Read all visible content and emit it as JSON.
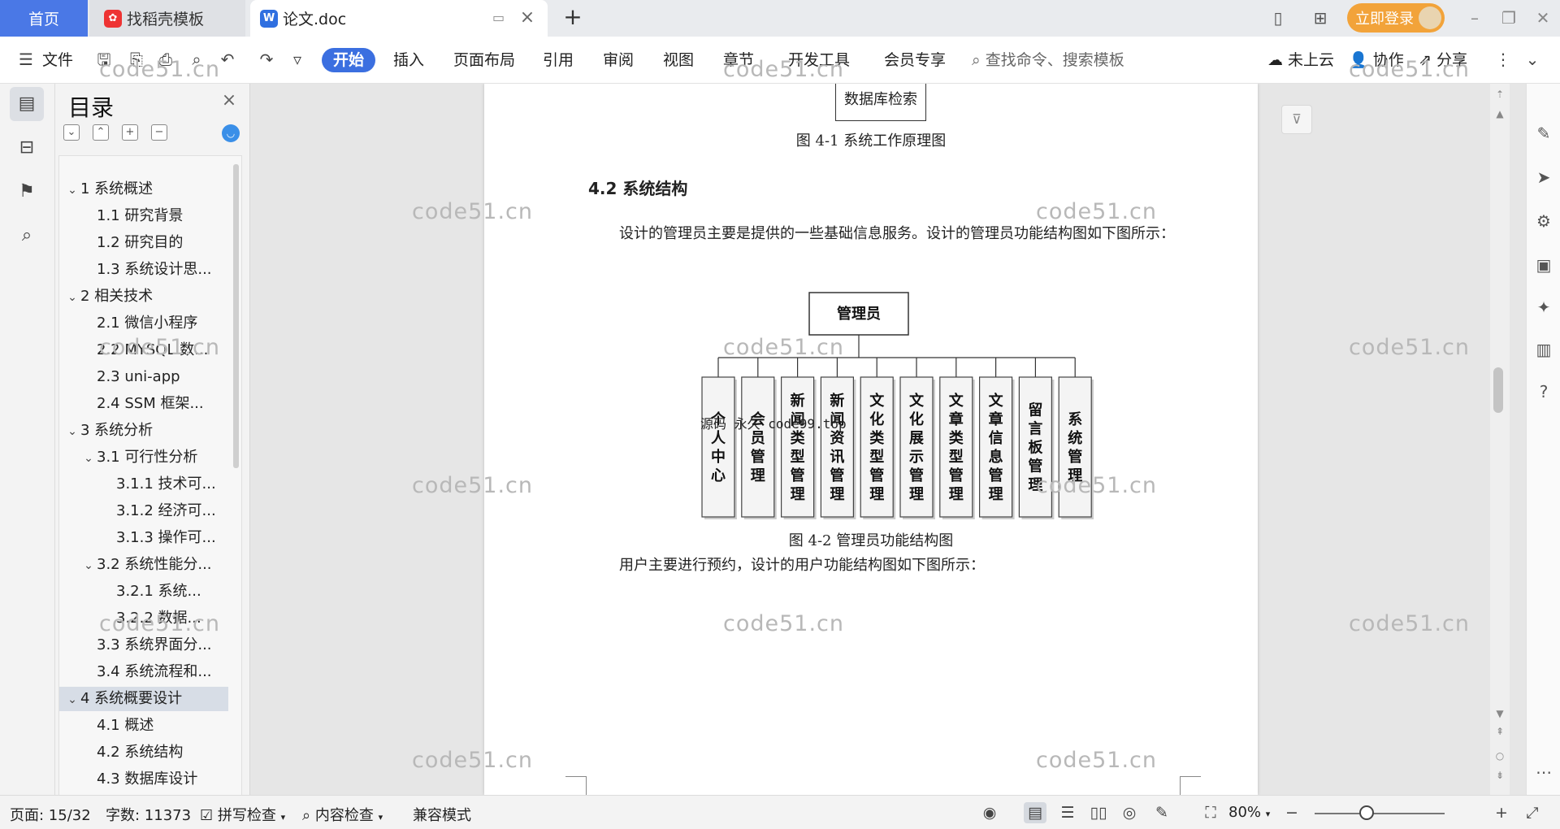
{
  "tabs": {
    "home": "首页",
    "templates": "找稻壳模板",
    "document": "论文.doc"
  },
  "header": {
    "login_label": "立即登录"
  },
  "ribbon": {
    "file_label": "文件",
    "menu": [
      "开始",
      "插入",
      "页面布局",
      "引用",
      "审阅",
      "视图",
      "章节",
      "开发工具",
      "会员专享"
    ],
    "search_placeholder": "查找命令、搜索模板",
    "cloud_label": "未上云",
    "collab_label": "协作",
    "share_label": "分享"
  },
  "toc": {
    "title": "目录",
    "items": [
      {
        "label": "1 系统概述",
        "level": 1,
        "chevron": true
      },
      {
        "label": "1.1  研究背景",
        "level": 2,
        "chevron": false
      },
      {
        "label": "1.2 研究目的",
        "level": 2,
        "chevron": false
      },
      {
        "label": "1.3 系统设计思...",
        "level": 2,
        "chevron": false
      },
      {
        "label": "2 相关技术",
        "level": 1,
        "chevron": true
      },
      {
        "label": "2.1 微信小程序",
        "level": 2,
        "chevron": false
      },
      {
        "label": "2.2 MYSQL 数...",
        "level": 2,
        "chevron": false
      },
      {
        "label": "2.3 uni-app",
        "level": 2,
        "chevron": false
      },
      {
        "label": "2.4 SSM 框架...",
        "level": 2,
        "chevron": false
      },
      {
        "label": "3 系统分析",
        "level": 1,
        "chevron": true
      },
      {
        "label": "3.1 可行性分析",
        "level": 2,
        "chevron": true
      },
      {
        "label": "3.1.1 技术可...",
        "level": 3,
        "chevron": false
      },
      {
        "label": "3.1.2 经济可...",
        "level": 3,
        "chevron": false
      },
      {
        "label": "3.1.3 操作可...",
        "level": 3,
        "chevron": false
      },
      {
        "label": "3.2 系统性能分...",
        "level": 2,
        "chevron": true
      },
      {
        "label": "3.2.1  系统...",
        "level": 3,
        "chevron": false
      },
      {
        "label": "3.2.2  数据...",
        "level": 3,
        "chevron": false
      },
      {
        "label": "3.3 系统界面分...",
        "level": 2,
        "chevron": false
      },
      {
        "label": "3.4 系统流程和...",
        "level": 2,
        "chevron": false
      },
      {
        "label": "4 系统概要设计",
        "level": 1,
        "chevron": true,
        "selected": true
      },
      {
        "label": "4.1 概述",
        "level": 2,
        "chevron": false
      },
      {
        "label": "4.2 系统结构",
        "level": 2,
        "chevron": false
      },
      {
        "label": "4.3 数据库设计",
        "level": 2,
        "chevron": false
      }
    ]
  },
  "document": {
    "db_box_label": "数据库检索",
    "fig41_caption": "图 4-1 系统工作原理图",
    "section_heading": "4.2 系统结构",
    "para1": "设计的管理员主要是提供的一些基础信息服务。设计的管理员功能结构图如下图所示：",
    "chart_root": "管理员",
    "chart_children": [
      "个人中心",
      "会员管理",
      "新闻类型管理",
      "新闻资讯管理",
      "文化类型管理",
      "文化展示管理",
      "文章类型管理",
      "文章信息管理",
      "留言板管理",
      "系统管理"
    ],
    "fig42_caption": "图 4-2 管理员功能结构图",
    "para2": "用户主要进行预约，设计的用户功能结构图如下图所示：",
    "overlay_text": "源码 永久 code99.top"
  },
  "watermark": "code51.cn",
  "status": {
    "page": "页面: 15/32",
    "words": "字数: 11373",
    "spellcheck": "拼写检查",
    "content_check": "内容检查",
    "compat_mode": "兼容模式",
    "zoom": "80%",
    "zoom_fraction": 0.4
  }
}
